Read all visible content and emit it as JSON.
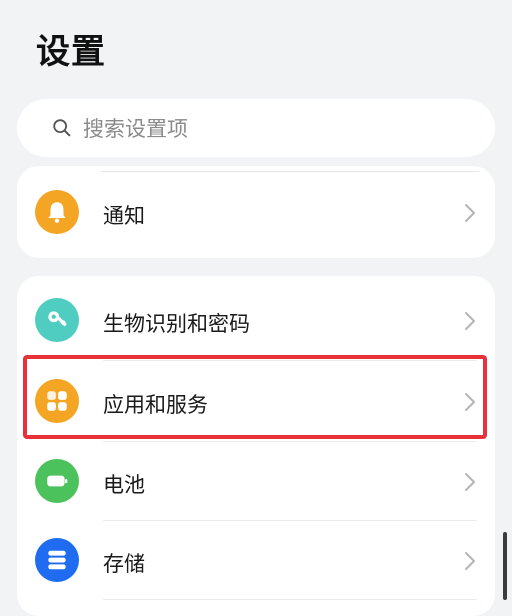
{
  "page": {
    "title": "设置"
  },
  "search": {
    "placeholder": "搜索设置项"
  },
  "items": [
    {
      "label": "通知",
      "icon": "bell-icon",
      "color": "#f5a524"
    },
    {
      "label": "生物识别和密码",
      "icon": "key-icon",
      "color": "#4ecdc0"
    },
    {
      "label": "应用和服务",
      "icon": "apps-grid-icon",
      "color": "#f5a524"
    },
    {
      "label": "电池",
      "icon": "battery-icon",
      "color": "#4cc25c"
    },
    {
      "label": "存储",
      "icon": "storage-icon",
      "color": "#1f6cf0"
    }
  ],
  "colors": {
    "background": "#f1f3f5",
    "card": "#ffffff",
    "highlight_border": "#e8323a"
  }
}
